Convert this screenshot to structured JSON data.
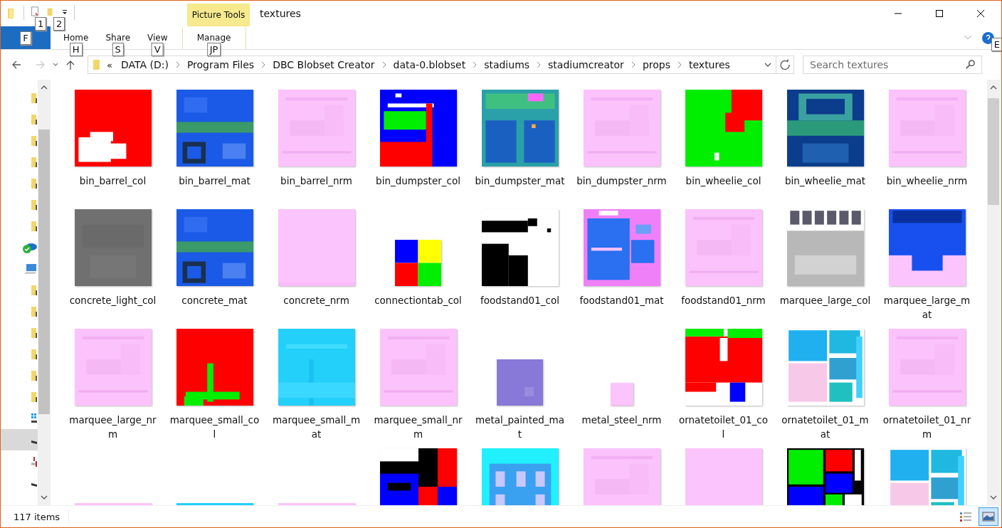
{
  "window": {
    "title": "textures"
  },
  "quick_access": {
    "keytips": [
      "1",
      "2"
    ]
  },
  "ribbon": {
    "file_tab": {
      "keytip": "F"
    },
    "tabs": [
      {
        "label": "Home",
        "keytip": "H"
      },
      {
        "label": "Share",
        "keytip": "S"
      },
      {
        "label": "View",
        "keytip": "V"
      }
    ],
    "contextual": {
      "header": "Picture Tools",
      "tabs": [
        {
          "label": "Manage",
          "keytip": "JP"
        }
      ]
    },
    "help_keytip": "E"
  },
  "address": {
    "overflow": "«",
    "crumbs": [
      "DATA (D:)",
      "Program Files",
      "DBC Blobset Creator",
      "data-0.blobset",
      "stadiums",
      "stadiumcreator",
      "props",
      "textures"
    ]
  },
  "search": {
    "placeholder": "Search textures"
  },
  "nav": [
    {
      "kind": "folder",
      "selected": false
    },
    {
      "kind": "folder",
      "selected": false
    },
    {
      "kind": "folder",
      "selected": false
    },
    {
      "kind": "folder",
      "selected": false
    },
    {
      "kind": "folder",
      "selected": false
    },
    {
      "kind": "folder",
      "selected": false
    },
    {
      "kind": "folder",
      "selected": false
    },
    {
      "kind": "cloud",
      "selected": false
    },
    {
      "kind": "pc",
      "selected": false
    },
    {
      "kind": "folder",
      "selected": false
    },
    {
      "kind": "folder",
      "selected": false
    },
    {
      "kind": "folder",
      "selected": false
    },
    {
      "kind": "folder",
      "selected": false
    },
    {
      "kind": "folder",
      "selected": false
    },
    {
      "kind": "folder",
      "selected": false
    },
    {
      "kind": "windows",
      "selected": false
    },
    {
      "kind": "drive",
      "selected": true
    },
    {
      "kind": "usb",
      "selected": false
    },
    {
      "kind": "drive",
      "selected": false
    }
  ],
  "items": [
    {
      "name": "bin_barrel_col",
      "kind": "red-white"
    },
    {
      "name": "bin_barrel_mat",
      "kind": "blue-mat"
    },
    {
      "name": "bin_barrel_nrm",
      "kind": "pink"
    },
    {
      "name": "bin_dumpster_col",
      "kind": "blue-red-green"
    },
    {
      "name": "bin_dumpster_mat",
      "kind": "teal-mat"
    },
    {
      "name": "bin_dumpster_nrm",
      "kind": "pink"
    },
    {
      "name": "bin_wheelie_col",
      "kind": "green-red"
    },
    {
      "name": "bin_wheelie_mat",
      "kind": "navy-teal"
    },
    {
      "name": "bin_wheelie_nrm",
      "kind": "pink"
    },
    {
      "name": "concrete_light_col",
      "kind": "gray"
    },
    {
      "name": "concrete_mat",
      "kind": "blue-mat"
    },
    {
      "name": "concrete_nrm",
      "kind": "pink-plain"
    },
    {
      "name": "connectiontab_col",
      "kind": "quad-small"
    },
    {
      "name": "foodstand01_col",
      "kind": "bw"
    },
    {
      "name": "foodstand01_mat",
      "kind": "blue-panel"
    },
    {
      "name": "foodstand01_nrm",
      "kind": "pink"
    },
    {
      "name": "marquee_large_col",
      "kind": "gray-marquee"
    },
    {
      "name": "marquee_large_mat",
      "kind": "blue-pink"
    },
    {
      "name": "marquee_large_nrm",
      "kind": "pink"
    },
    {
      "name": "marquee_small_col",
      "kind": "red-green"
    },
    {
      "name": "marquee_small_mat",
      "kind": "cyan"
    },
    {
      "name": "marquee_small_nrm",
      "kind": "pink"
    },
    {
      "name": "metal_painted_mat",
      "kind": "purple-small"
    },
    {
      "name": "metal_steel_nrm",
      "kind": "pink-tiny"
    },
    {
      "name": "ornatetoilet_01_col",
      "kind": "red-green-white"
    },
    {
      "name": "ornatetoilet_01_mat",
      "kind": "cyan-atlas"
    },
    {
      "name": "ornatetoilet_01_nrm",
      "kind": "pink"
    },
    {
      "kind": "pink-strip"
    },
    {
      "kind": "cyan-strip"
    },
    {
      "kind": "pink-strip"
    },
    {
      "kind": "blue-black-red"
    },
    {
      "kind": "cyan-tiles"
    },
    {
      "kind": "pink"
    },
    {
      "kind": "pink-plain"
    },
    {
      "kind": "green-red-atlas"
    },
    {
      "kind": "cyan-atlas"
    }
  ],
  "status_bar": {
    "count": "117 items",
    "views": [
      {
        "kind": "details",
        "selected": false
      },
      {
        "kind": "large-icons",
        "selected": true
      }
    ]
  }
}
